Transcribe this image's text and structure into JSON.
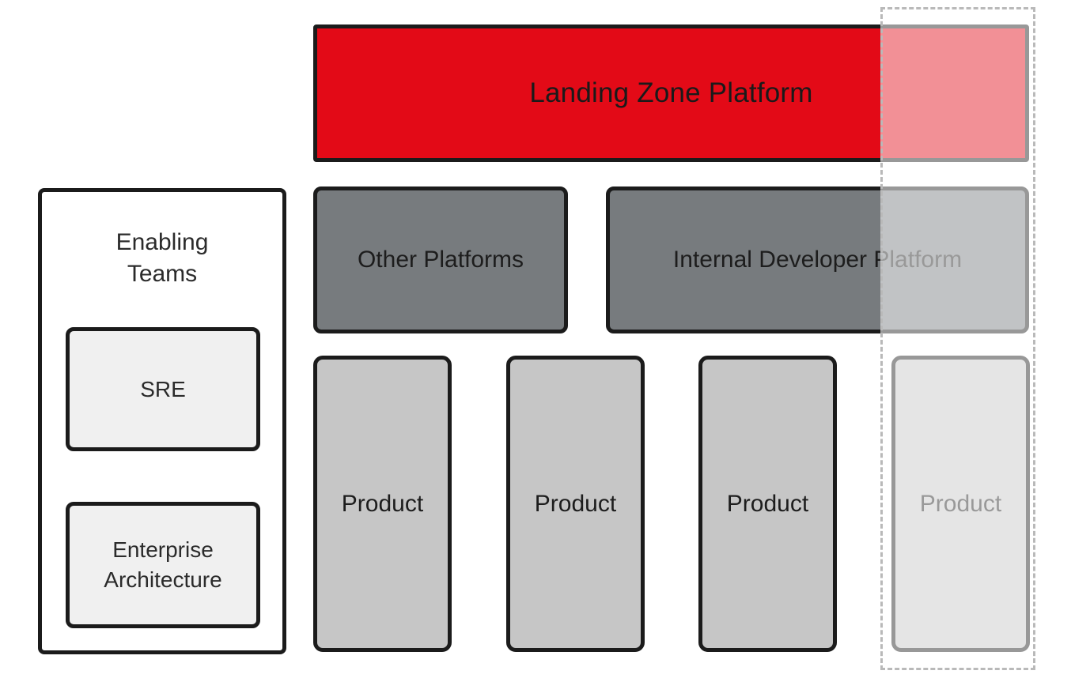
{
  "diagram": {
    "title_block": {
      "label": "Landing Zone Platform",
      "color": "#e30a17",
      "text_color": "#1a1a1a"
    },
    "enabling_teams": {
      "title": "Enabling\nTeams",
      "title_line1": "Enabling",
      "title_line2": "Teams",
      "members": [
        {
          "label": "SRE",
          "color": "#f0f0f0"
        },
        {
          "label": "Enterprise\nArchitecture",
          "line1": "Enterprise",
          "line2": "Architecture",
          "color": "#f0f0f0"
        }
      ]
    },
    "platforms": [
      {
        "label": "Other Platforms",
        "color": "#777b7e"
      },
      {
        "label": "Internal Developer Platform",
        "color": "#777b7e"
      }
    ],
    "products": [
      {
        "label": "Product",
        "color": "#c6c6c6"
      },
      {
        "label": "Product",
        "color": "#c6c6c6"
      },
      {
        "label": "Product",
        "color": "#c6c6c6"
      },
      {
        "label": "Product",
        "color": "#c6c6c6"
      }
    ],
    "scope_highlight": {
      "style": "dashed",
      "border_color": "#b9b9b9",
      "overlay_color": "rgba(255,255,255,0.55)"
    }
  }
}
